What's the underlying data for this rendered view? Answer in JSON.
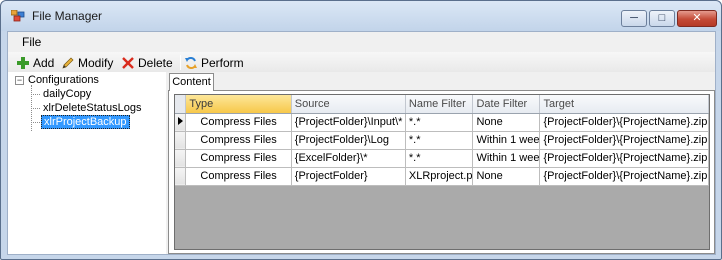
{
  "window": {
    "title": "File Manager",
    "controls": {
      "minimize": "─",
      "maximize": "□",
      "close": "✕"
    }
  },
  "menu": {
    "items": [
      "File"
    ]
  },
  "toolbar": {
    "add_label": "Add",
    "modify_label": "Modify",
    "delete_label": "Delete",
    "perform_label": "Perform"
  },
  "tree": {
    "root": "Configurations",
    "expander": "−",
    "children": [
      "dailyCopy",
      "xlrDeleteStatusLogs",
      "xlrProjectBackup"
    ],
    "selected": "xlrProjectBackup"
  },
  "tabs": [
    {
      "label": "Content",
      "active": true
    }
  ],
  "grid": {
    "columns": [
      "Type",
      "Source",
      "Name Filter",
      "Date Filter",
      "Target"
    ],
    "selected_column": "Type",
    "current_row": 0,
    "rows": [
      [
        "Compress Files",
        "{ProjectFolder}\\Input\\*",
        "*.*",
        "None",
        "{ProjectFolder}\\{ProjectName}.zip"
      ],
      [
        "Compress Files",
        "{ProjectFolder}\\Log",
        "*.*",
        "Within 1 wee",
        "{ProjectFolder}\\{ProjectName}.zip"
      ],
      [
        "Compress Files",
        "{ExcelFolder}\\*",
        "*.*",
        "Within 1 wee",
        "{ProjectFolder}\\{ProjectName}.zip"
      ],
      [
        "Compress Files",
        "{ProjectFolder}",
        "XLRproject.p",
        "None",
        "{ProjectFolder}\\{ProjectName}.zip"
      ]
    ]
  },
  "colors": {
    "selection": "#3399ff",
    "selected_header": "#f7c84a",
    "grid_background": "#aaaaaa",
    "add_icon": "#3a9a2a",
    "delete_icon": "#d92b1d"
  },
  "icons": [
    "app-icon",
    "add-icon",
    "modify-icon",
    "delete-icon",
    "perform-icon",
    "row-indicator-icon"
  ]
}
